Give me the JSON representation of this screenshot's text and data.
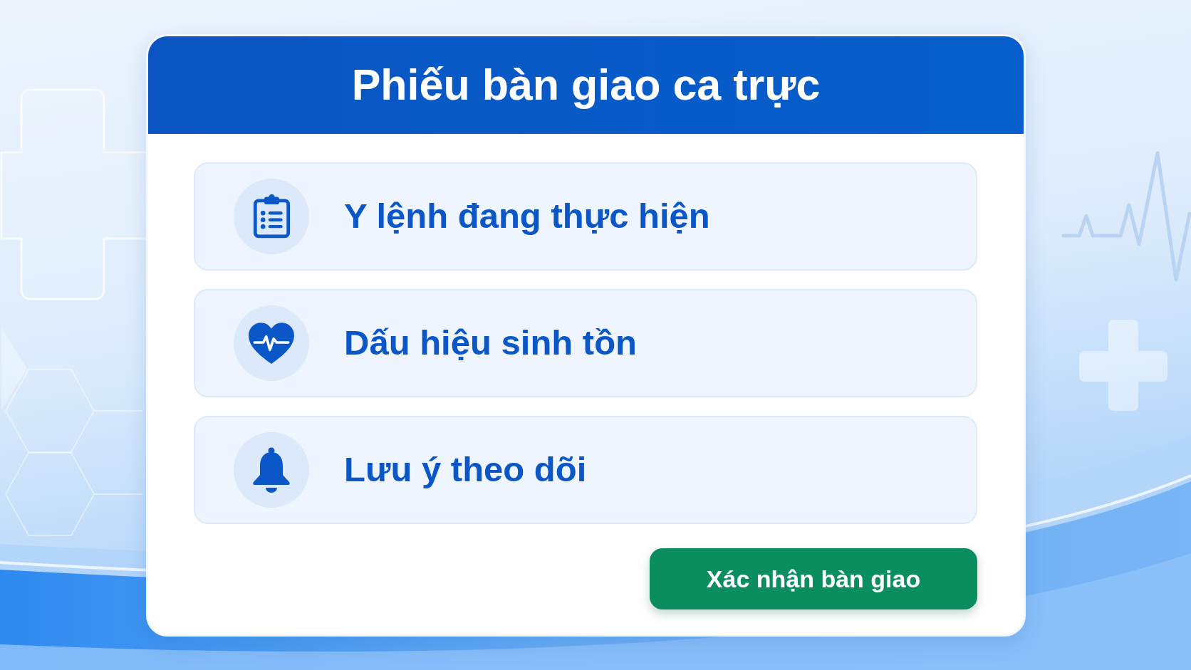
{
  "title": "Phiếu bàn giao ca trực",
  "sections": [
    {
      "label": "Y lệnh đang thực hiện"
    },
    {
      "label": "Dấu hiệu sinh tồn"
    },
    {
      "label": "Lưu ý theo dõi"
    }
  ],
  "confirm_button": {
    "label": "Xác nhận bàn giao"
  }
}
